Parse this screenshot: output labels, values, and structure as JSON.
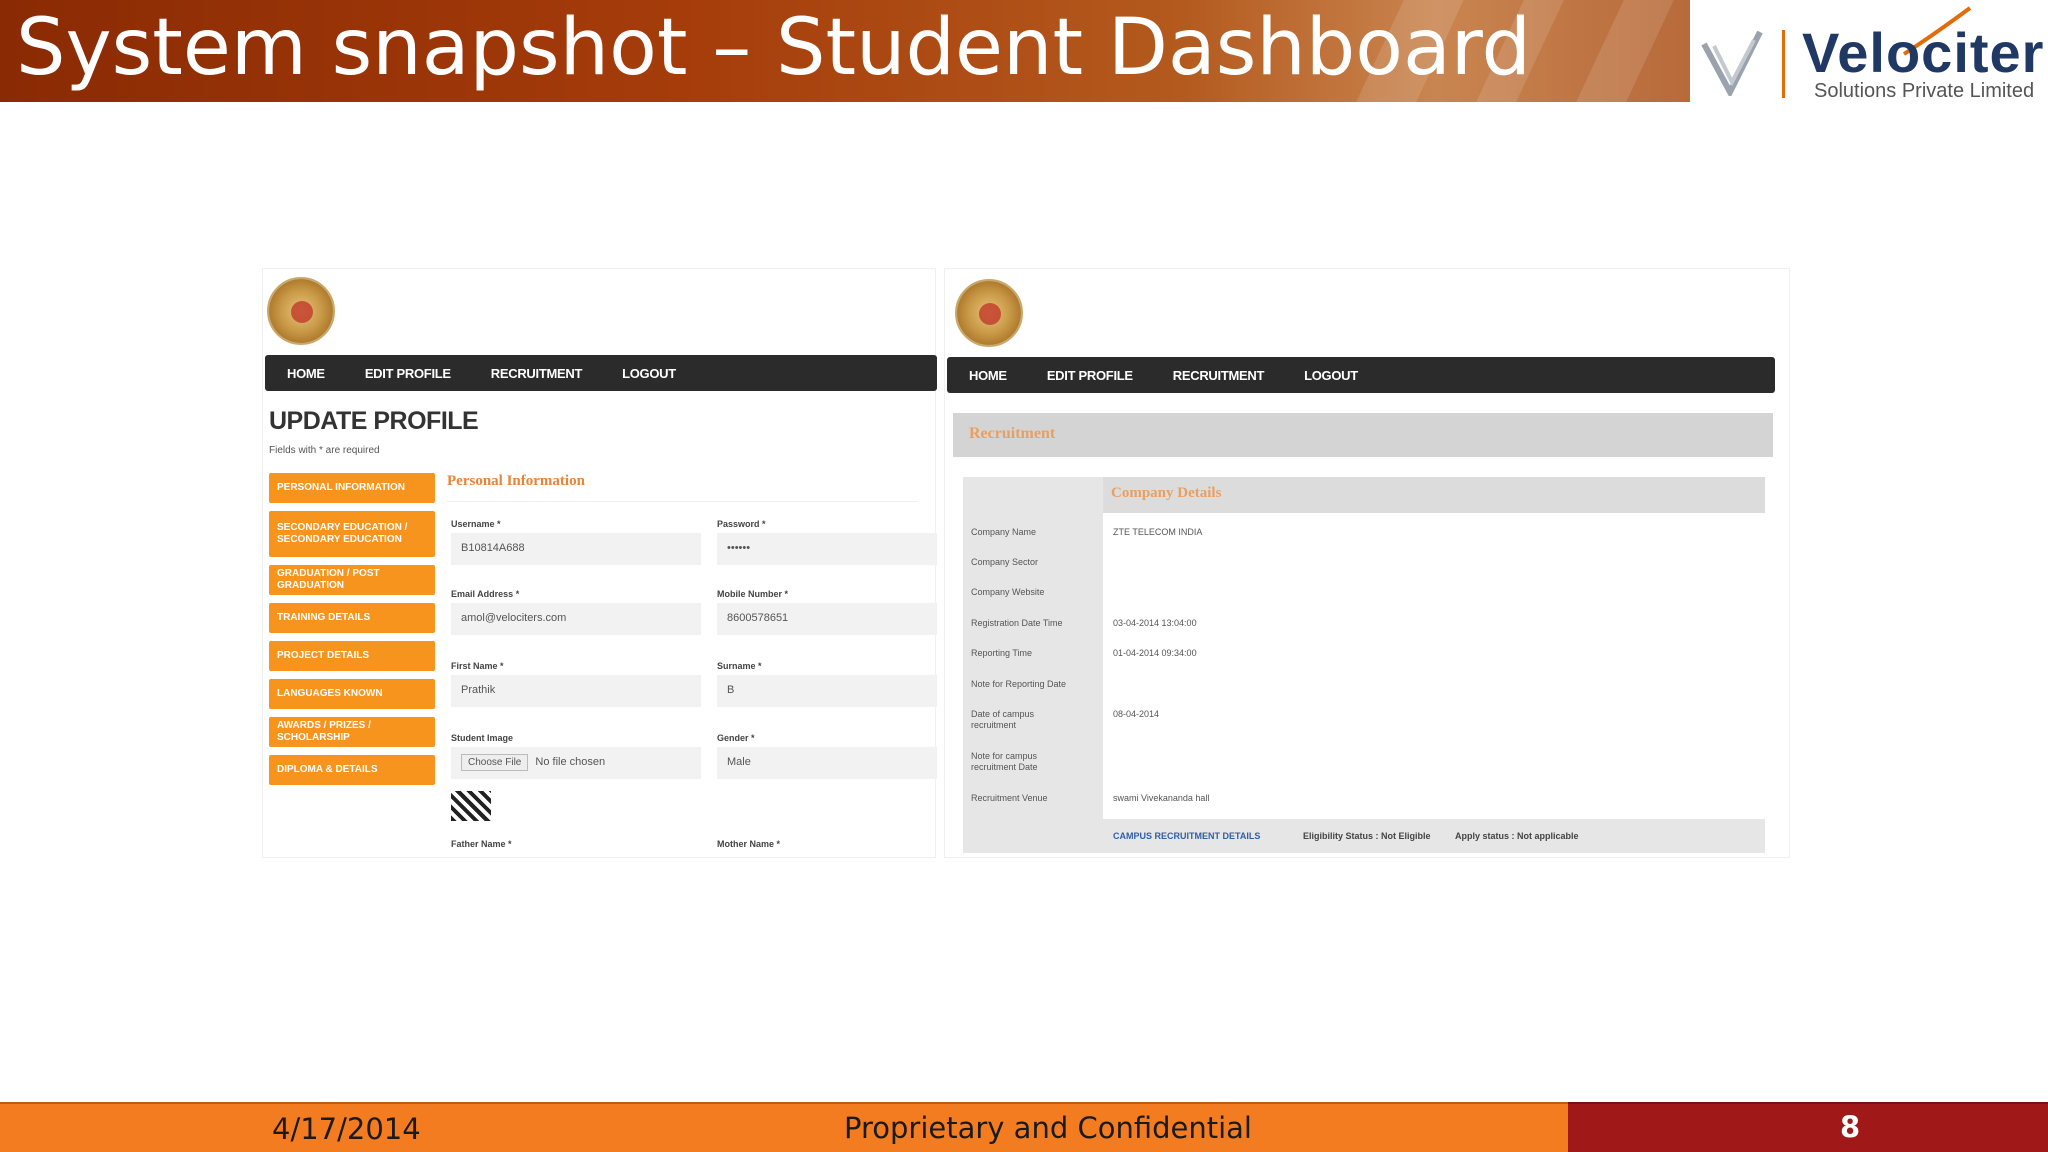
{
  "slide": {
    "title": "System snapshot – Student Dashboard",
    "logo": {
      "name": "Velociter",
      "subtitle": "Solutions Private Limited"
    },
    "footer": {
      "date": "4/17/2014",
      "confidential": "Proprietary and Confidential",
      "page": "8"
    }
  },
  "left_screen": {
    "nav": [
      "HOME",
      "EDIT PROFILE",
      "RECRUITMENT",
      "LOGOUT"
    ],
    "heading": "UPDATE PROFILE",
    "required_note": "Fields with * are required",
    "sidebar": [
      "PERSONAL INFORMATION",
      "SECONDARY EDUCATION / SECONDARY EDUCATION",
      "GRADUATION / POST GRADUATION",
      "TRAINING DETAILS",
      "PROJECT DETAILS",
      "LANGUAGES KNOWN",
      "AWARDS / PRIZES / SCHOLARSHIP",
      "DIPLOMA & DETAILS"
    ],
    "section_title": "Personal Information",
    "fields": {
      "username_label": "Username *",
      "username_value": "B10814A688",
      "password_label": "Password *",
      "password_value": "••••••",
      "email_label": "Email Address *",
      "email_value": "amol@velociters.com",
      "mobile_label": "Mobile Number *",
      "mobile_value": "8600578651",
      "firstname_label": "First Name *",
      "firstname_value": "Prathik",
      "surname_label": "Surname *",
      "surname_value": "B",
      "image_label": "Student Image",
      "file_button": "Choose File",
      "file_status": "No file chosen",
      "gender_label": "Gender *",
      "gender_value": "Male",
      "father_label": "Father Name *",
      "mother_label": "Mother Name *"
    }
  },
  "right_screen": {
    "nav": [
      "HOME",
      "EDIT PROFILE",
      "RECRUITMENT",
      "LOGOUT"
    ],
    "banner": "Recruitment",
    "company_details_title": "Company Details",
    "rows": [
      {
        "label": "Company Name",
        "value": "ZTE TELECOM INDIA"
      },
      {
        "label": "Company Sector",
        "value": ""
      },
      {
        "label": "Company Website",
        "value": ""
      },
      {
        "label": "Registration Date Time",
        "value": "03-04-2014 13:04:00"
      },
      {
        "label": "Reporting Time",
        "value": "01-04-2014 09:34:00"
      },
      {
        "label": "Note for Reporting Date",
        "value": ""
      },
      {
        "label": "Date of campus recruitment",
        "value": "08-04-2014"
      },
      {
        "label": "Note for campus recruitment Date",
        "value": ""
      },
      {
        "label": "Recruitment Venue",
        "value": "swami Vivekananda hall"
      }
    ],
    "footer_link": "CAMPUS RECRUITMENT DETAILS",
    "eligibility": "Eligibility Status : Not Eligible",
    "apply_status": "Apply status : Not applicable"
  }
}
